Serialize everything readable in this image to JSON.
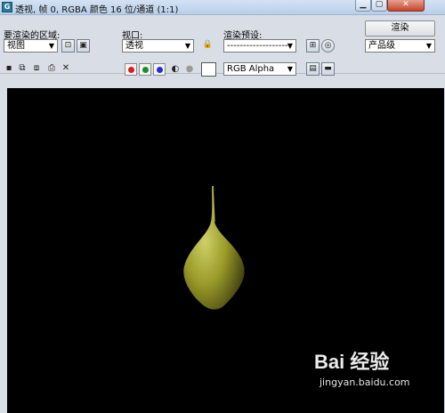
{
  "window": {
    "title": "透视, 帧 0, RGBA 颜色 16 位/通道 (1:1)",
    "app_icon": "3ds-max-icon",
    "min_label": "▁",
    "max_label": "▢",
    "close_label": "✕"
  },
  "controls": {
    "area_label": "要渲染的区域:",
    "area_value": "视图",
    "viewport_label": "视口:",
    "viewport_value": "透视",
    "preset_label": "渲染预设:",
    "preset_value": "--------------------",
    "render_button": "渲染",
    "quality_value": "产品级"
  },
  "toolbar": {
    "channel_display": "RGB Alpha",
    "channel_colors": {
      "red": "#d81e1e",
      "green": "#1a8f2a",
      "blue": "#1e2fd8",
      "mono": "#9a9a9a"
    }
  },
  "render": {
    "background": "#000000",
    "object_color": "#a8a82e"
  },
  "watermark": {
    "brand": "Bai 经验",
    "url": "jingyan.baidu.com"
  }
}
